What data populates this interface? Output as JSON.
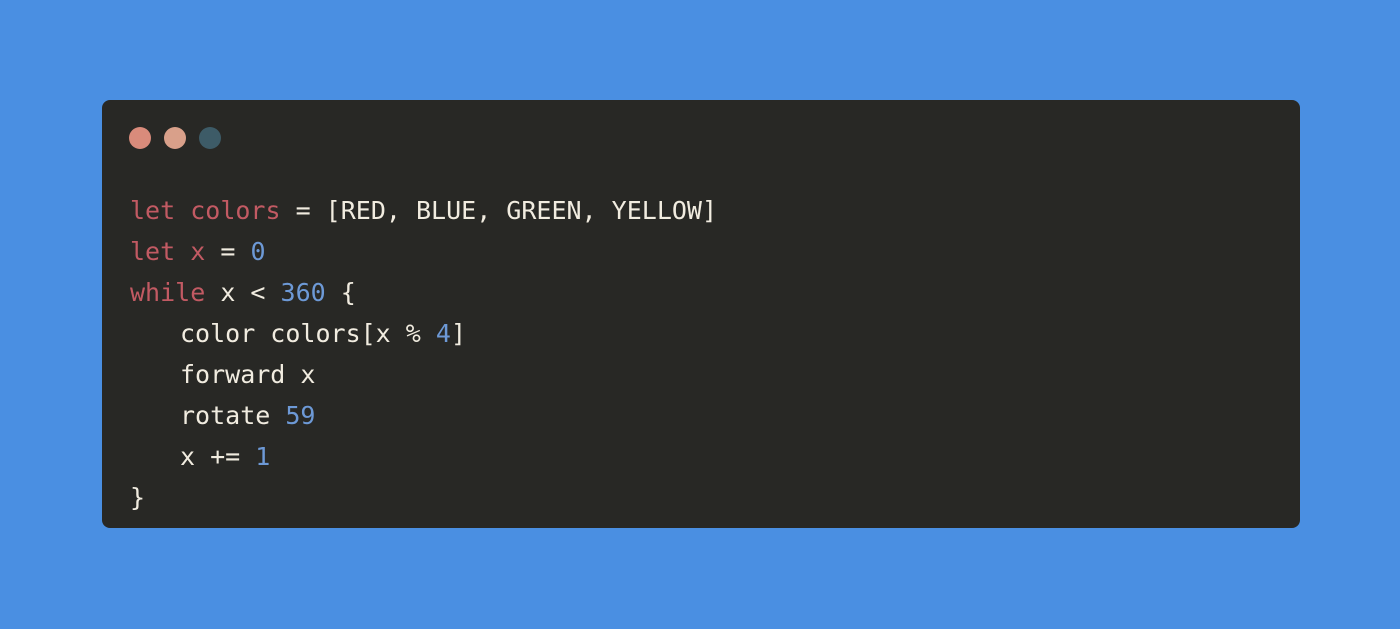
{
  "window": {
    "controls": [
      {
        "name": "close",
        "color": "#d98b7b"
      },
      {
        "name": "minimize",
        "color": "#d9a08a"
      },
      {
        "name": "maximize",
        "color": "#3d5b67"
      }
    ]
  },
  "code": {
    "language": "turtle-script",
    "lines": [
      {
        "tokens": [
          {
            "type": "kw",
            "text": "let"
          },
          {
            "type": "plain",
            "text": " "
          },
          {
            "type": "var",
            "text": "colors"
          },
          {
            "type": "plain",
            "text": " = [RED, BLUE, GREEN, YELLOW]"
          }
        ]
      },
      {
        "tokens": [
          {
            "type": "kw",
            "text": "let"
          },
          {
            "type": "plain",
            "text": " "
          },
          {
            "type": "var",
            "text": "x"
          },
          {
            "type": "plain",
            "text": " = "
          },
          {
            "type": "num",
            "text": "0"
          }
        ]
      },
      {
        "tokens": [
          {
            "type": "kw",
            "text": "while"
          },
          {
            "type": "plain",
            "text": " x < "
          },
          {
            "type": "num",
            "text": "360"
          },
          {
            "type": "plain",
            "text": " {"
          }
        ]
      },
      {
        "indent": true,
        "tokens": [
          {
            "type": "plain",
            "text": "color colors[x % "
          },
          {
            "type": "num",
            "text": "4"
          },
          {
            "type": "plain",
            "text": "]"
          }
        ]
      },
      {
        "indent": true,
        "tokens": [
          {
            "type": "plain",
            "text": "forward x"
          }
        ]
      },
      {
        "indent": true,
        "tokens": [
          {
            "type": "plain",
            "text": "rotate "
          },
          {
            "type": "num",
            "text": "59"
          }
        ]
      },
      {
        "indent": true,
        "tokens": [
          {
            "type": "plain",
            "text": "x += "
          },
          {
            "type": "num",
            "text": "1"
          }
        ]
      },
      {
        "tokens": [
          {
            "type": "plain",
            "text": "}"
          }
        ]
      }
    ]
  }
}
